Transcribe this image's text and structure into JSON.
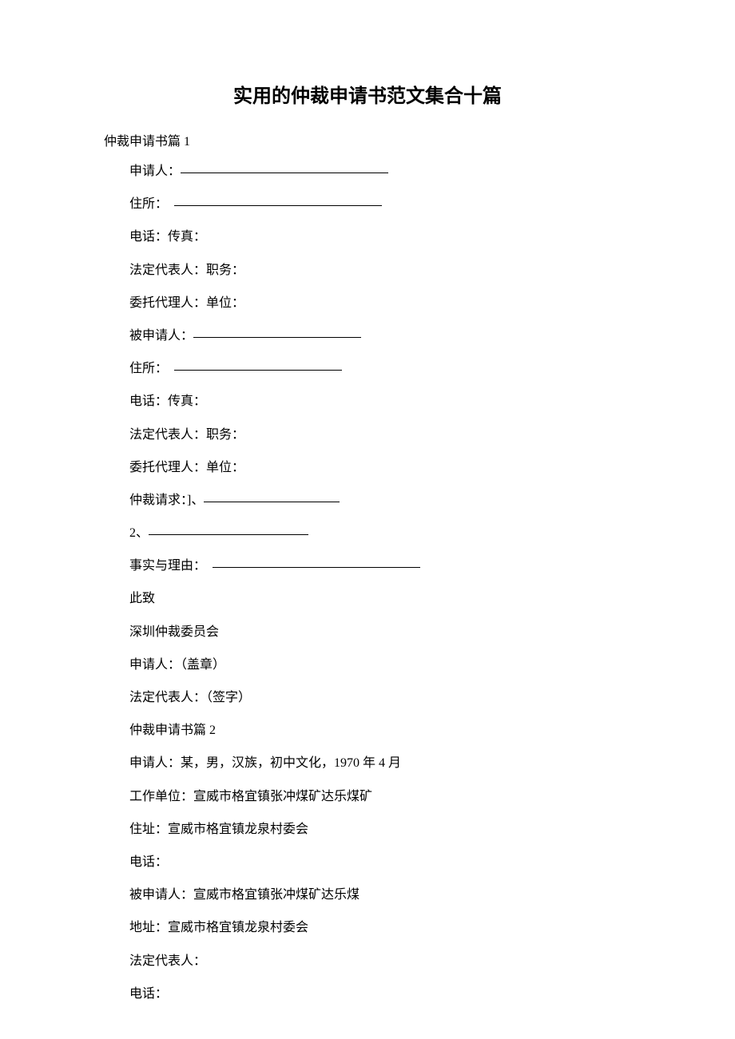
{
  "title": "实用的仲裁申请书范文集合十篇",
  "section1": {
    "header": "仲裁申请书篇 1",
    "lines": {
      "applicant": "申请人：",
      "address": "住所：",
      "phonefax": "电话：传真：",
      "legalrep": "法定代表人：职务：",
      "agent": "委托代理人：单位：",
      "respondent": "被申请人：",
      "address2": "住所：",
      "phonefax2": "电话：传真：",
      "legalrep2": "法定代表人：职务：",
      "agent2": "委托代理人：单位：",
      "request": "仲裁请求：]、",
      "item2": "2、",
      "facts": "事实与理由：",
      "cizhi": "此致",
      "committee": "深圳仲裁委员会",
      "applicantSeal": "申请人：（盖章）",
      "legalrepSign": "法定代表人：（签字）"
    }
  },
  "section2": {
    "header": "仲裁申请书篇 2",
    "lines": {
      "applicant": "申请人：某，男，汉族，初中文化，1970 年 4 月",
      "workunit": "工作单位：宣威市格宜镇张冲煤矿达乐煤矿",
      "address": "住址：宣威市格宜镇龙泉村委会",
      "phone": "电话：",
      "respondent": "被申请人：宣威市格宜镇张冲煤矿达乐煤",
      "address2": "地址：宣威市格宜镇龙泉村委会",
      "legalrep": "法定代表人：",
      "phone2": "电话："
    }
  }
}
